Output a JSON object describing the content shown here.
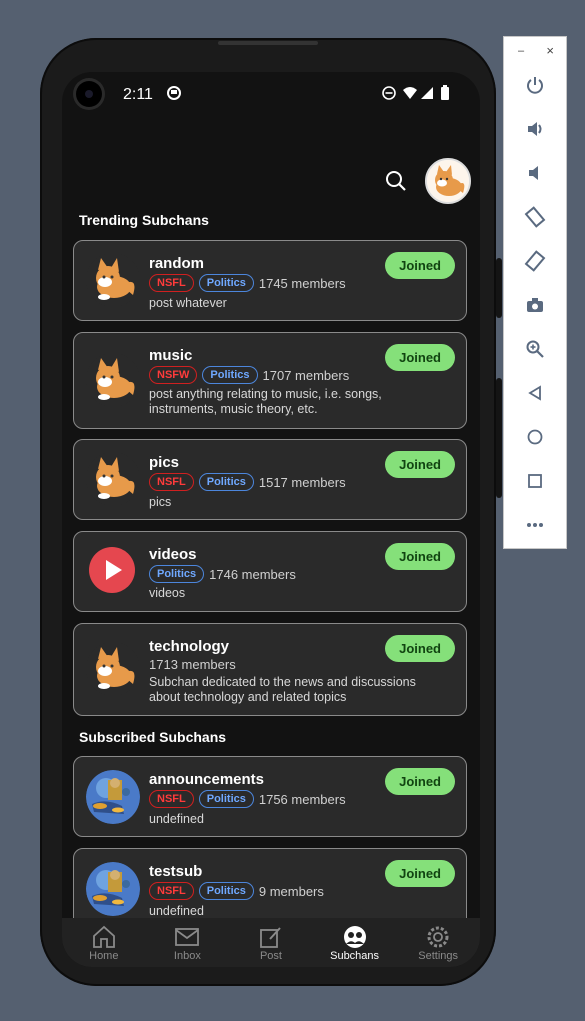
{
  "status_bar": {
    "time": "2:11"
  },
  "sections": {
    "trending": "Trending Subchans",
    "subscribed": "Subscribed Subchans"
  },
  "cards": [
    {
      "name": "random",
      "tags": [
        "NSFL",
        "Politics"
      ],
      "members": "1745 members",
      "desc": "post whatever",
      "button": "Joined",
      "icon": "fox-icon"
    },
    {
      "name": "music",
      "tags": [
        "NSFW",
        "Politics"
      ],
      "members": "1707 members",
      "desc": "post anything relating to music, i.e. songs, instruments, music theory, etc.",
      "button": "Joined",
      "icon": "fox-icon"
    },
    {
      "name": "pics",
      "tags": [
        "NSFL",
        "Politics"
      ],
      "members": "1517 members",
      "desc": "pics",
      "button": "Joined",
      "icon": "fox-icon"
    },
    {
      "name": "videos",
      "tags": [
        "Politics"
      ],
      "members": "1746 members",
      "desc": "videos",
      "button": "Joined",
      "icon": "play-icon"
    },
    {
      "name": "technology",
      "tags": [],
      "members": "1713 members",
      "desc": "Subchan dedicated to the news and discussions about technology and related topics",
      "button": "Joined",
      "icon": "fox-icon"
    },
    {
      "name": "announcements",
      "tags": [
        "NSFL",
        "Politics"
      ],
      "members": "1756 members",
      "desc": "undefined",
      "button": "Joined",
      "icon": "painting-icon"
    },
    {
      "name": "testsub",
      "tags": [
        "NSFL",
        "Politics"
      ],
      "members": "9 members",
      "desc": "undefined",
      "button": "Joined",
      "icon": "painting-icon"
    }
  ],
  "nav": [
    "Home",
    "Inbox",
    "Post",
    "Subchans",
    "Settings"
  ],
  "emulator_toolbar": {
    "minimize": "–",
    "close": "×"
  }
}
